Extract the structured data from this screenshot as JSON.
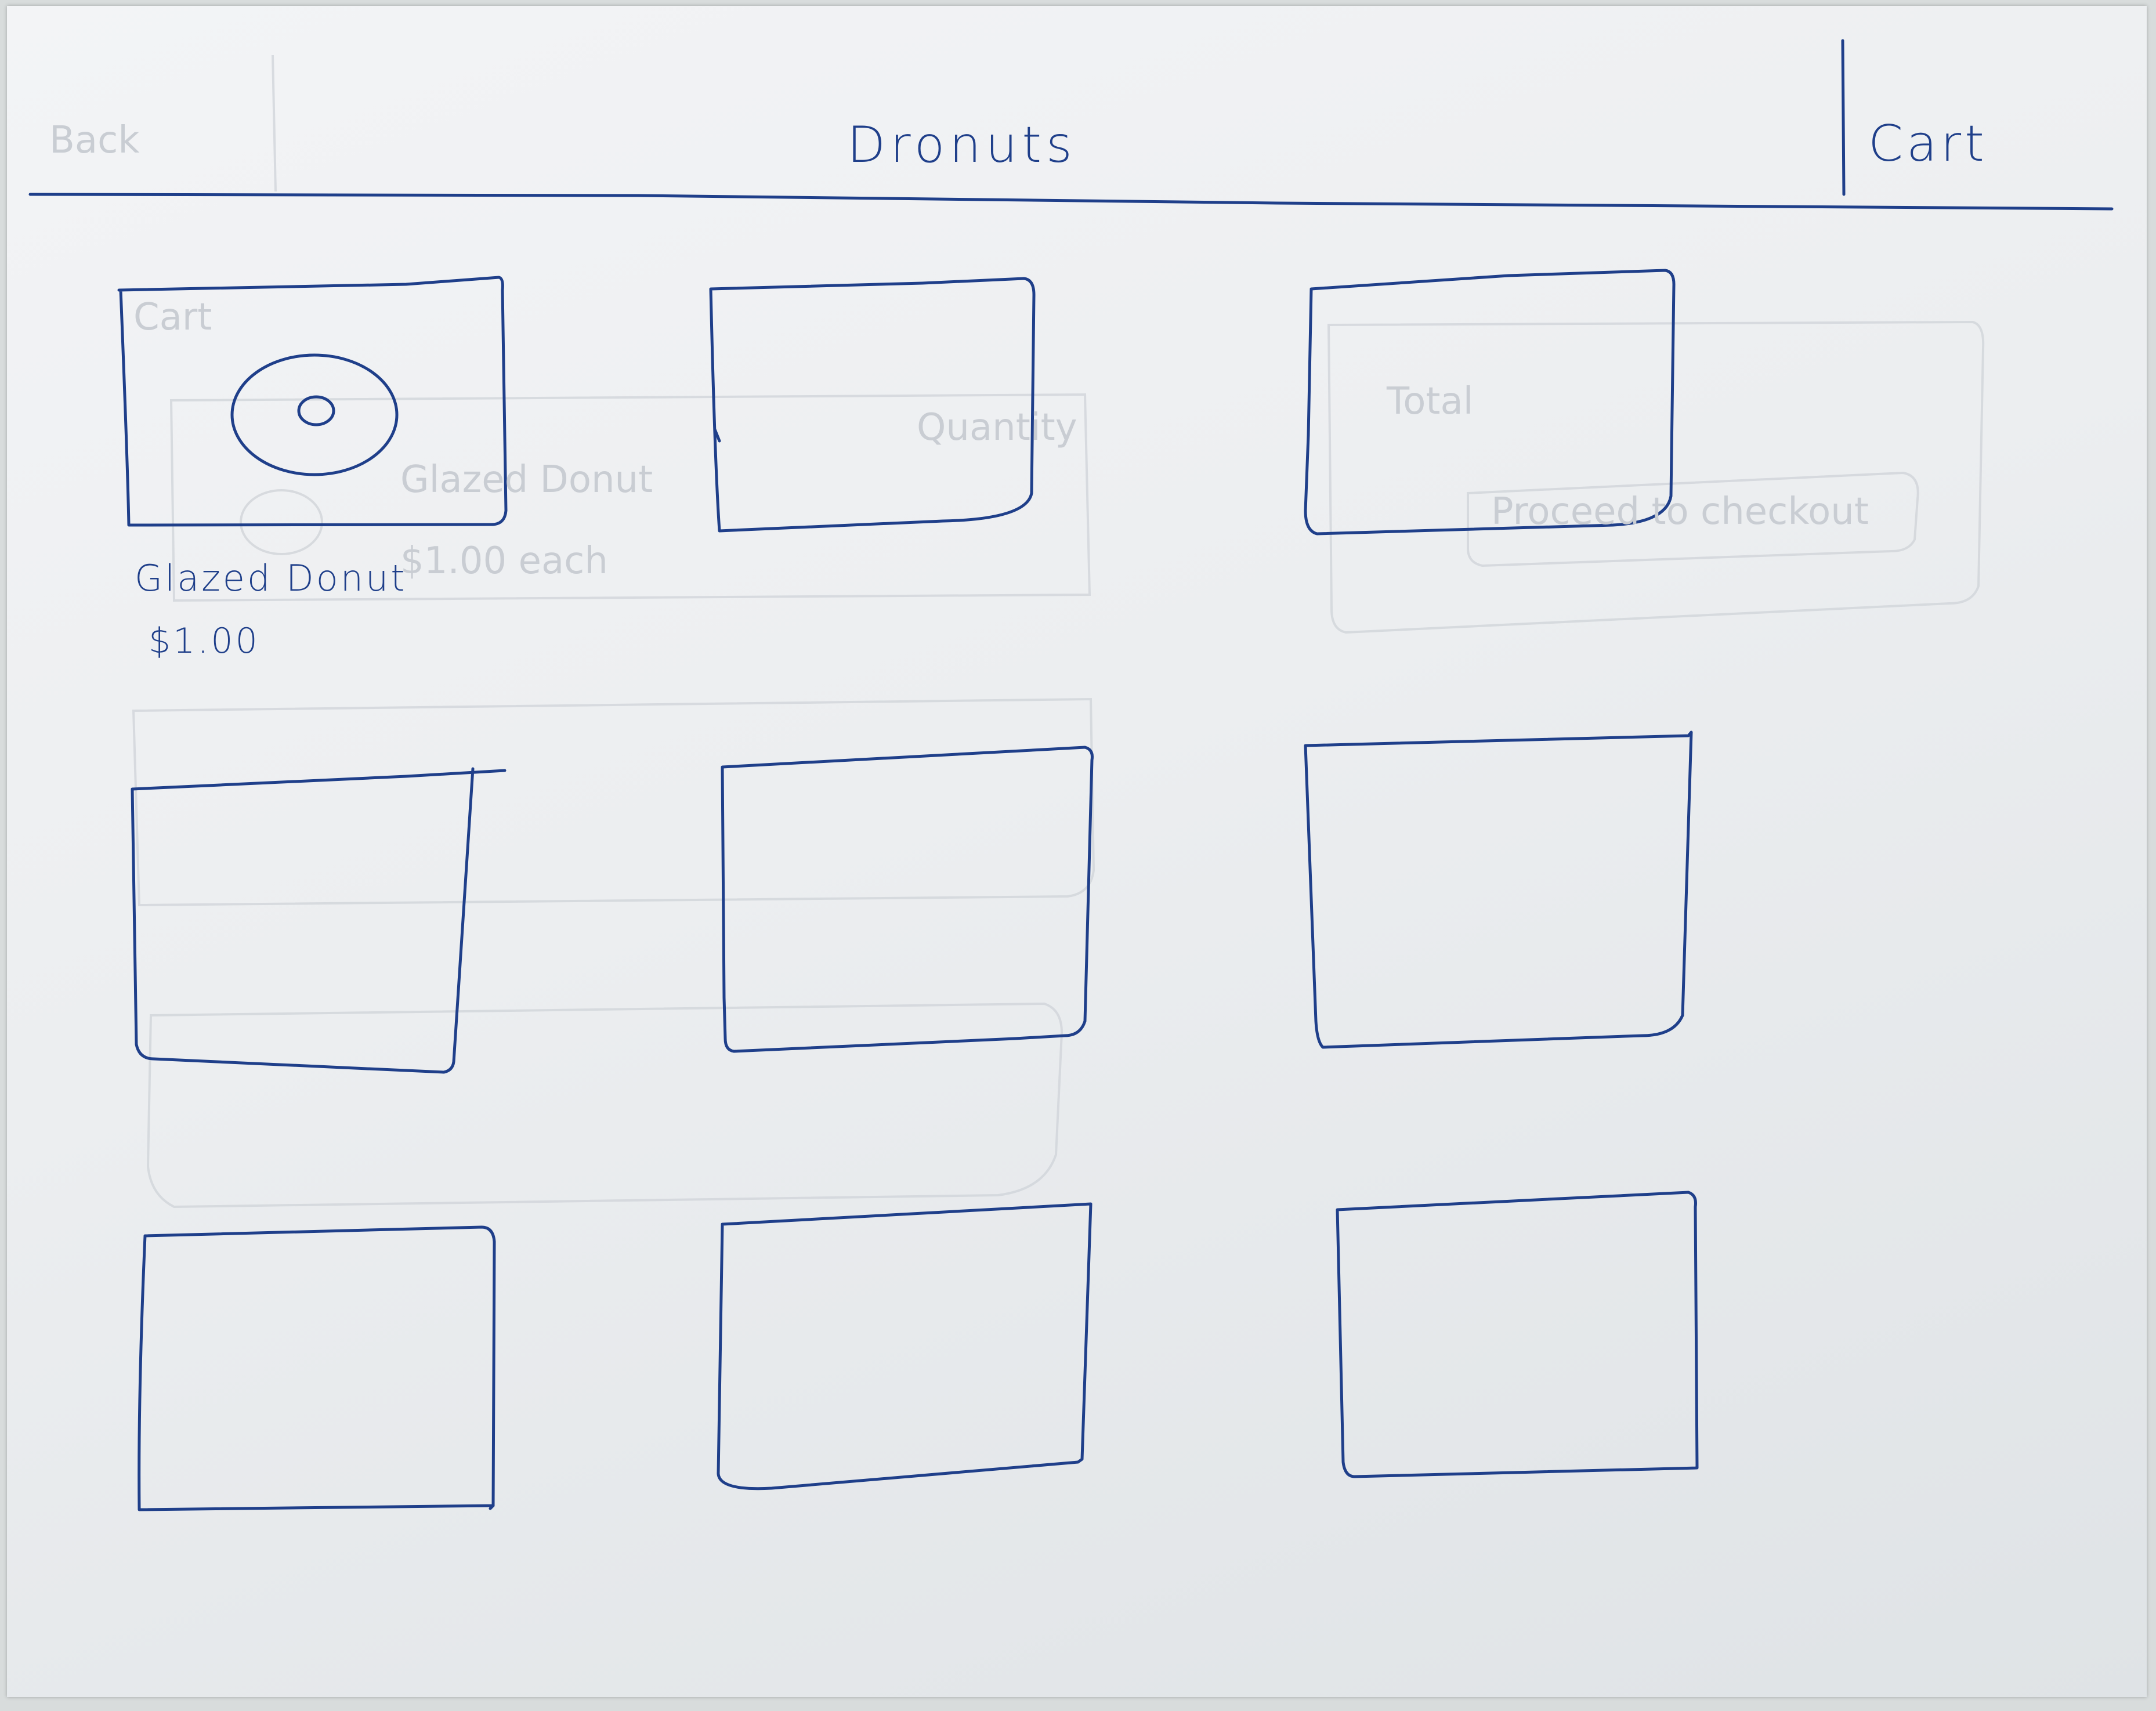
{
  "header": {
    "title": "Dronuts",
    "cart_label": "Cart"
  },
  "products": [
    {
      "name": "Glazed Donut",
      "price": "$1.00",
      "image_icon": "donut-icon"
    },
    {
      "name": "",
      "price": ""
    },
    {
      "name": "",
      "price": ""
    },
    {
      "name": "",
      "price": ""
    },
    {
      "name": "",
      "price": ""
    },
    {
      "name": "",
      "price": ""
    },
    {
      "name": "",
      "price": ""
    },
    {
      "name": "",
      "price": ""
    },
    {
      "name": "",
      "price": ""
    }
  ],
  "colors": {
    "ink": "#1f3f8a",
    "paper": "#eef0f2",
    "ghost": "#c9cdd3"
  }
}
